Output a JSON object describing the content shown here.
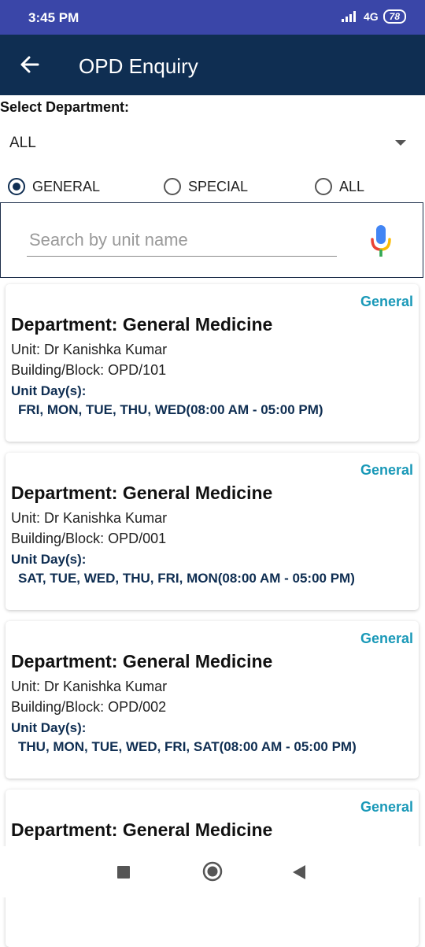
{
  "status_bar": {
    "time": "3:45 PM",
    "network": "4G",
    "battery": "78"
  },
  "app_bar": {
    "title": "OPD Enquiry",
    "back_icon": "arrow-left-icon"
  },
  "department": {
    "label": "Select Department:",
    "selected": "ALL"
  },
  "filters": [
    {
      "label": "GENERAL",
      "checked": true
    },
    {
      "label": "SPECIAL",
      "checked": false
    },
    {
      "label": "ALL",
      "checked": false
    }
  ],
  "search": {
    "placeholder": "Search by unit name",
    "value": "",
    "mic_icon": "microphone-icon"
  },
  "cards": [
    {
      "badge": "General",
      "department": "Department: General Medicine",
      "unit": "Unit: Dr Kanishka Kumar",
      "building": "Building/Block:  OPD/101",
      "days_label": "Unit Day(s):",
      "days": "FRI, MON, TUE, THU, WED(08:00 AM - 05:00 PM)"
    },
    {
      "badge": "General",
      "department": "Department: General Medicine",
      "unit": "Unit: Dr Kanishka Kumar",
      "building": "Building/Block:  OPD/001",
      "days_label": "Unit Day(s):",
      "days": "SAT, TUE, WED, THU, FRI, MON(08:00 AM - 05:00 PM)"
    },
    {
      "badge": "General",
      "department": "Department: General Medicine",
      "unit": "Unit: Dr Kanishka Kumar",
      "building": "Building/Block:  OPD/002",
      "days_label": "Unit Day(s):",
      "days": "THU, MON, TUE, WED, FRI, SAT(08:00 AM - 05:00 PM)"
    },
    {
      "badge": "General",
      "department": "Department: General Medicine"
    }
  ],
  "nav": {
    "recents_icon": "square-icon",
    "home_icon": "circle-icon",
    "back_icon": "triangle-back-icon"
  },
  "colors": {
    "status_bar": "#3a46a8",
    "app_bar": "#0f2e52",
    "badge": "#1a99b8",
    "days_text": "#0f2e52"
  }
}
